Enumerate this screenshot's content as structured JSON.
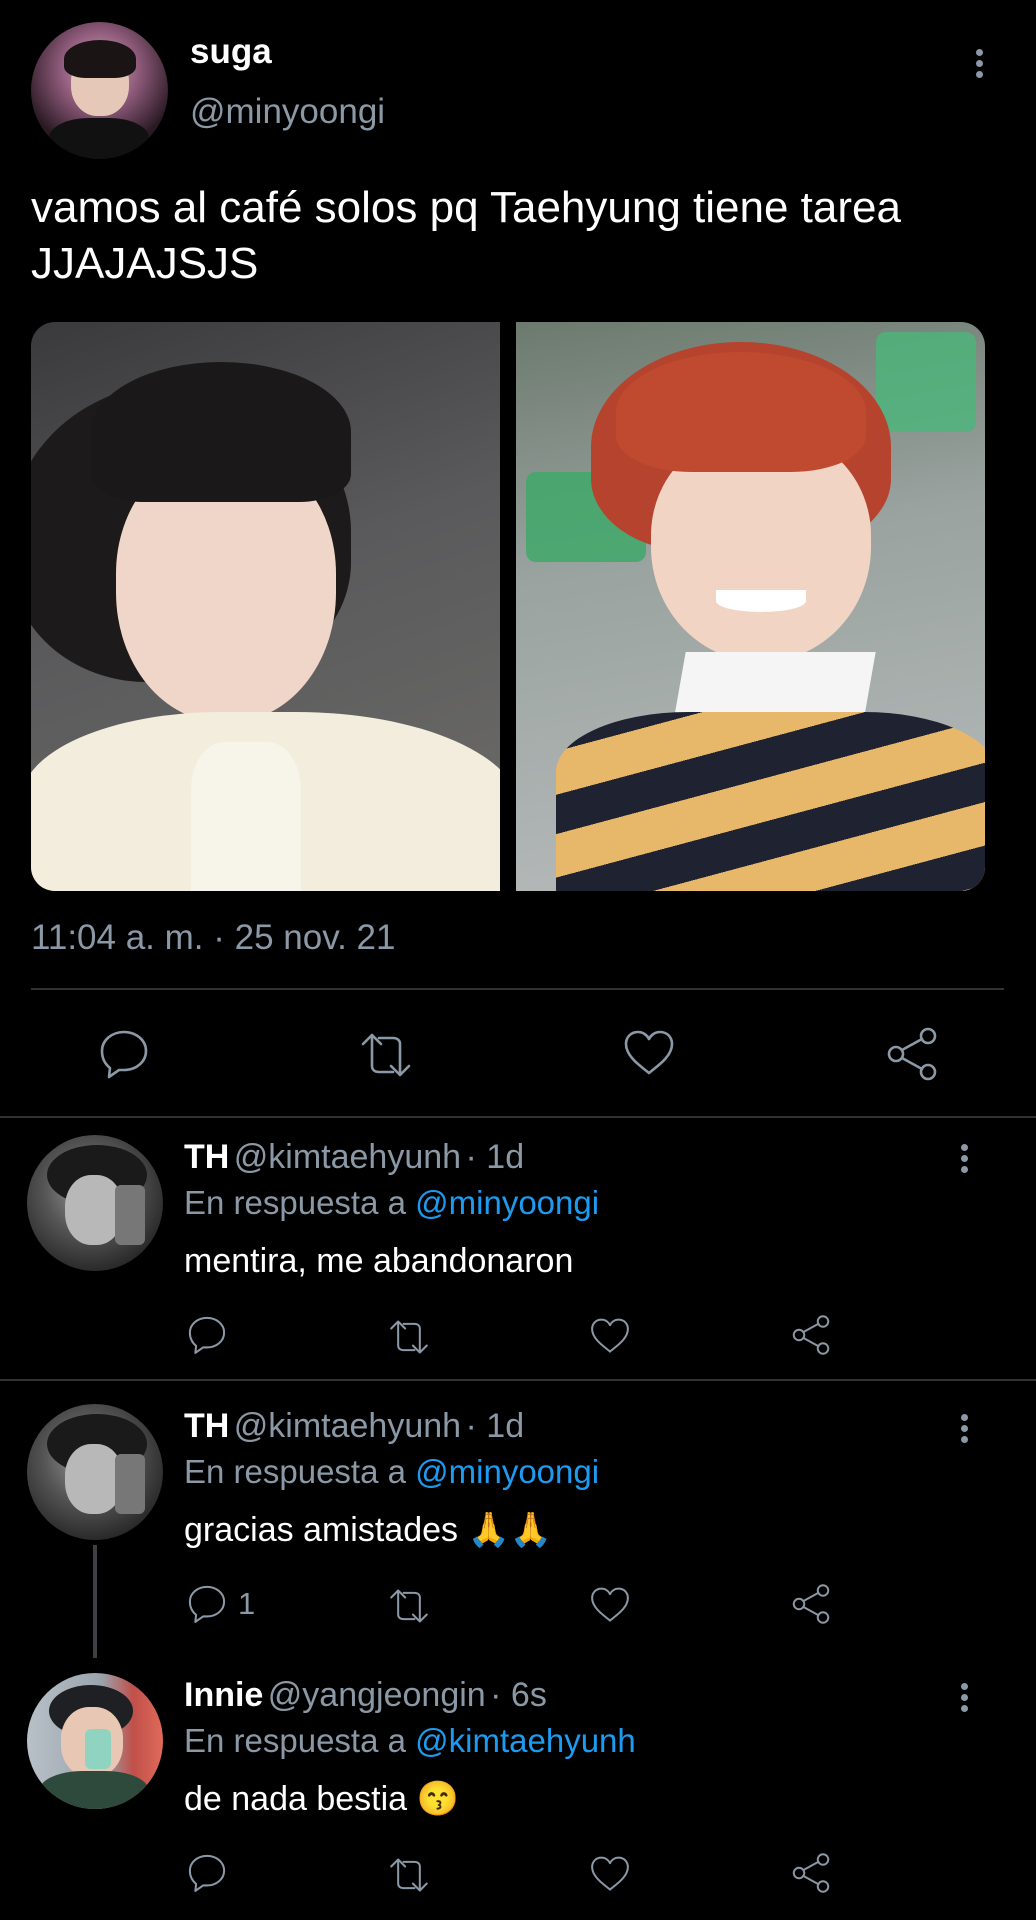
{
  "tweet": {
    "display_name": "suga",
    "handle": "@minyoongi",
    "text_line1": "vamos al café solos pq Taehyung tiene tarea",
    "text_line2": "JJAJAJSJS",
    "timestamp": "11:04 a. m. · 25 nov. 21",
    "icons": [
      "reply-icon",
      "retweet-icon",
      "like-icon",
      "share-icon",
      "more-icon"
    ]
  },
  "replies": [
    {
      "name": "TH",
      "handle": "@kimtaehyunh",
      "time": "· 1d",
      "in_reply_prefix": "En respuesta a",
      "in_reply_to": "@minyoongi",
      "text": "mentira, me abandonaron",
      "reply_count": ""
    },
    {
      "name": "TH",
      "handle": "@kimtaehyunh",
      "time": "· 1d",
      "in_reply_prefix": "En respuesta a",
      "in_reply_to": "@minyoongi",
      "text": "gracias amistades",
      "emoji": "🙏🙏",
      "reply_count": "1"
    },
    {
      "name": "Innie",
      "handle": "@yangjeongin",
      "time": "· 6s",
      "in_reply_prefix": "En respuesta a",
      "in_reply_to": "@kimtaehyunh",
      "text": "de nada bestia",
      "emoji": "😙",
      "reply_count": ""
    }
  ],
  "colors": {
    "background": "#000000",
    "muted": "#8b98a5",
    "link": "#1d9bf0",
    "divider": "#2f3336"
  }
}
